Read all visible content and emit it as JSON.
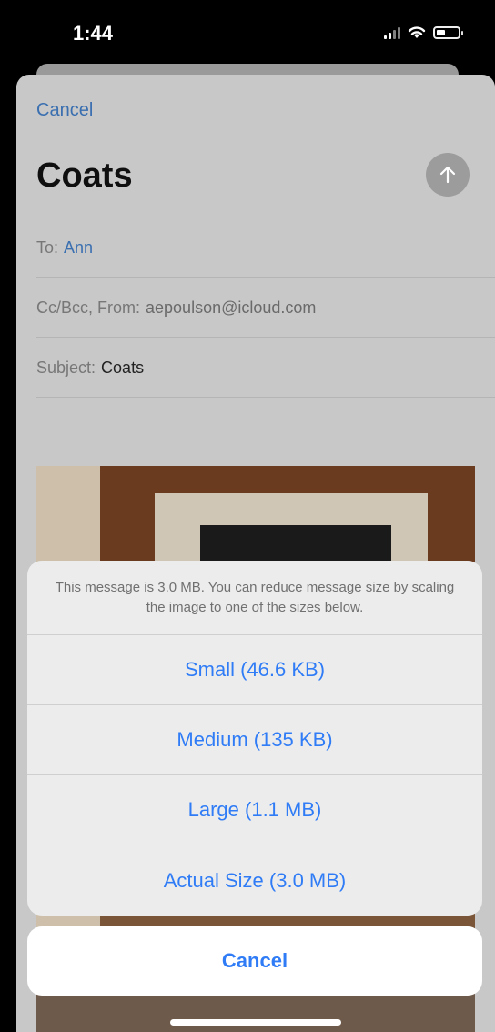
{
  "status_bar": {
    "time": "1:44"
  },
  "compose": {
    "cancel_label": "Cancel",
    "title": "Coats",
    "to_label": "To:",
    "to_value": "Ann",
    "cc_label": "Cc/Bcc, From:",
    "cc_value": "aepoulson@icloud.com",
    "subject_label": "Subject:",
    "subject_value": "Coats"
  },
  "action_sheet": {
    "message": "This message is 3.0 MB. You can reduce message size by scaling the image to one of the sizes below.",
    "options": [
      {
        "label": "Small (46.6 KB)"
      },
      {
        "label": "Medium (135 KB)"
      },
      {
        "label": "Large (1.1 MB)"
      },
      {
        "label": "Actual Size (3.0 MB)"
      }
    ],
    "cancel_label": "Cancel"
  },
  "colors": {
    "accent": "#2f7cf6",
    "link": "#3a6fb0"
  }
}
